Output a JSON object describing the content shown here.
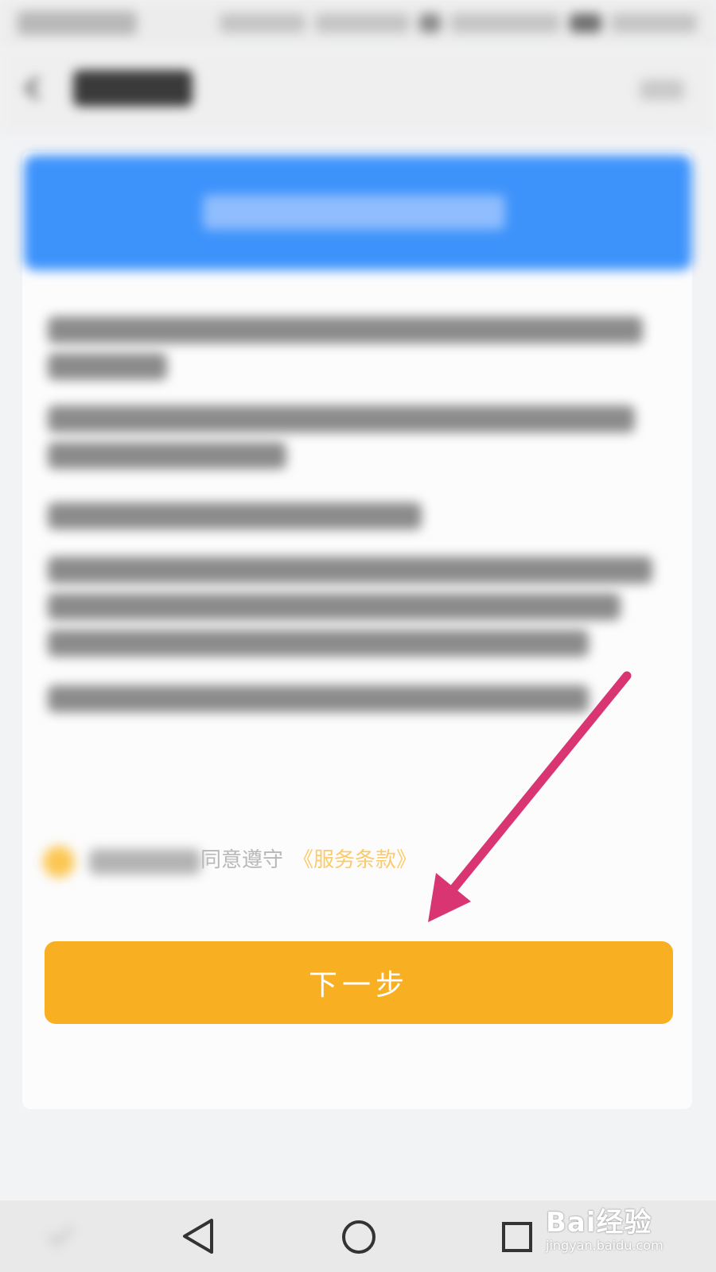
{
  "agreement": {
    "prefix_text": "同意遵守",
    "terms_link": "《服务条款》",
    "checkbox_color": "#fbc753"
  },
  "actions": {
    "next_label": "下一步",
    "next_color": "#f9af22"
  },
  "banner": {
    "color": "#3e93fb"
  },
  "annotation": {
    "arrow_color": "#d93573"
  },
  "navigation": {
    "icons": [
      "back-triangle-icon",
      "home-circle-icon",
      "recents-square-icon"
    ]
  },
  "watermark": {
    "logo": "Bai经验",
    "url": "jingyan.baidu.com"
  }
}
